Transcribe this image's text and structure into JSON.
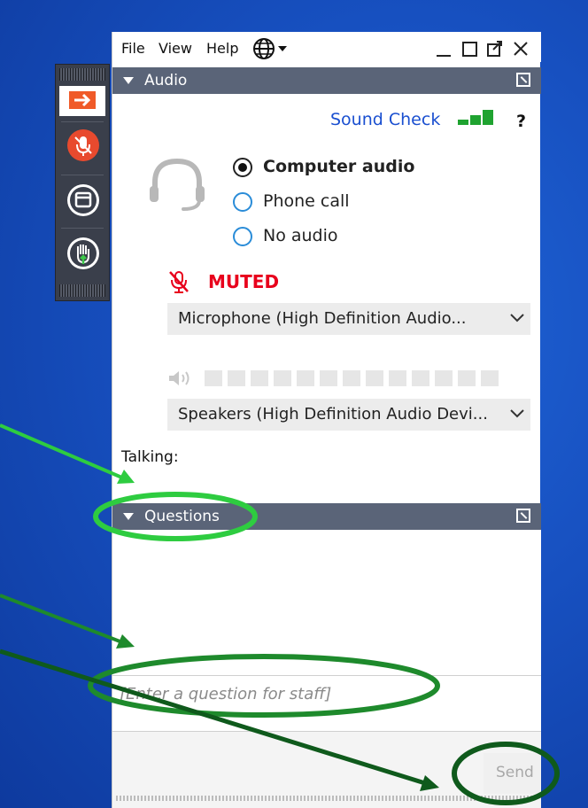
{
  "menubar": {
    "file": "File",
    "view": "View",
    "help": "Help"
  },
  "audio_panel": {
    "title": "Audio",
    "sound_check": "Sound Check",
    "help_mark": "?",
    "options": [
      {
        "label": "Computer audio",
        "selected": true
      },
      {
        "label": "Phone call",
        "selected": false
      },
      {
        "label": "No audio",
        "selected": false
      }
    ],
    "muted_label": "MUTED",
    "microphone": "Microphone (High Definition Audio...",
    "speakers": "Speakers (High Definition Audio Devi...",
    "talking_label": "Talking:"
  },
  "questions_panel": {
    "title": "Questions",
    "input_placeholder": "[Enter a question for staff]",
    "send_label": "Send"
  },
  "colors": {
    "header": "#5a6478",
    "accent": "#f05a28",
    "muted": "#e8001c",
    "link": "#1a4fd0",
    "annotation": "#2ecc40"
  },
  "icons": [
    "exit-icon",
    "mic-muted-icon",
    "window-icon",
    "raise-hand-icon",
    "globe-icon",
    "headset-icon",
    "speaker-icon",
    "signal-bars-icon"
  ]
}
